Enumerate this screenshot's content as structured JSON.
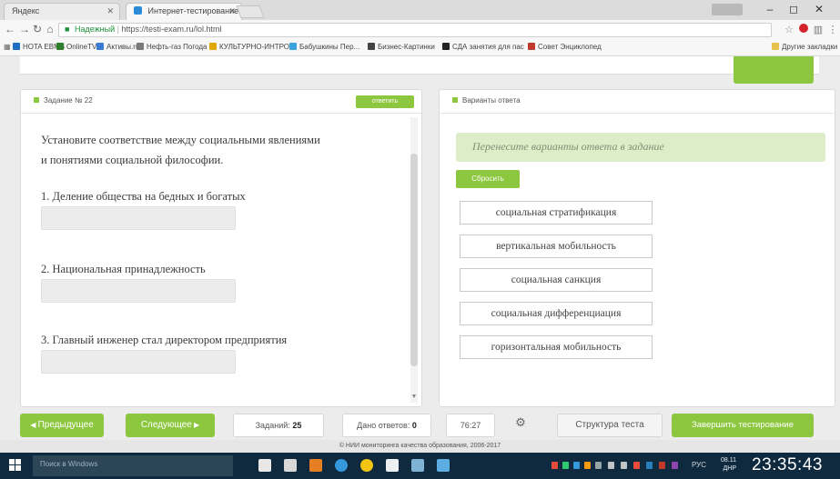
{
  "browser": {
    "tabs": [
      {
        "label": "Яндекс"
      },
      {
        "label": "Интернет-тестирование"
      }
    ],
    "window_controls": {
      "minimize": "–",
      "maximize": "◻",
      "close": "✕"
    },
    "address": {
      "prefix": "Надежный",
      "url": "https://testi-exam.ru/lol.html"
    },
    "bookmarks": [
      {
        "label": "HOTA EBMS",
        "color": "#1d6fc4"
      },
      {
        "label": "OnlineTV",
        "color": "#2d7d2d"
      },
      {
        "label": "Активы.ru",
        "color": "#3a7bd5"
      },
      {
        "label": "Нефть-газ Погода",
        "color": "#7a7a7a"
      },
      {
        "label": "КУЛЬТУРНО-ИНТРО",
        "color": "#e0a800"
      },
      {
        "label": "Бабушкины Пер...",
        "color": "#3aa3e0"
      },
      {
        "label": "Бизнес-Картинки",
        "color": "#444"
      },
      {
        "label": "СДА занятия для пас",
        "color": "#222"
      },
      {
        "label": "Совет Энциклопед",
        "color": "#c0392b"
      }
    ],
    "other_bookmarks": "Другие закладки"
  },
  "task": {
    "header": "Задание № 22",
    "header_button": "ответить",
    "question_line1": "Установите соответствие между социальными явлениями",
    "question_line2": "и понятиями социальной философии.",
    "items": [
      {
        "label": "1. Деление общества на бедных и богатых"
      },
      {
        "label": "2. Национальная принадлежность"
      },
      {
        "label": "3. Главный инженер стал директором предприятия"
      }
    ]
  },
  "answers": {
    "header": "Варианты ответа",
    "instruction": "Перенесите варианты ответа в задание",
    "reset_button": "Сбросить",
    "options": [
      {
        "label": "социальная стратификация"
      },
      {
        "label": "вертикальная мобильность"
      },
      {
        "label": "социальная санкция"
      },
      {
        "label": "социальная дифференциация"
      },
      {
        "label": "горизонтальная мобильность"
      }
    ]
  },
  "bottom": {
    "prev_button": "Предыдущее",
    "next_button": "Следующее",
    "tasks_label": "Заданий:",
    "tasks_value": "25",
    "answered_label": "Дано ответов:",
    "answered_value": "0",
    "timer": "76:27",
    "structure_button": "Структура теста",
    "finish_button": "Завершить тестирование"
  },
  "footer": "© НИИ мониторинга качества образования, 2006-2017",
  "taskbar": {
    "search_placeholder": "Поиск в Windows",
    "lang": "РУС",
    "date_line1": "08.11",
    "date_line2": "ДНР",
    "time": "23:35:43"
  },
  "colors": {
    "accent_green": "#8dc63f",
    "instruction_bg": "#dcedc8",
    "taskbar": "#0f2a3f"
  }
}
